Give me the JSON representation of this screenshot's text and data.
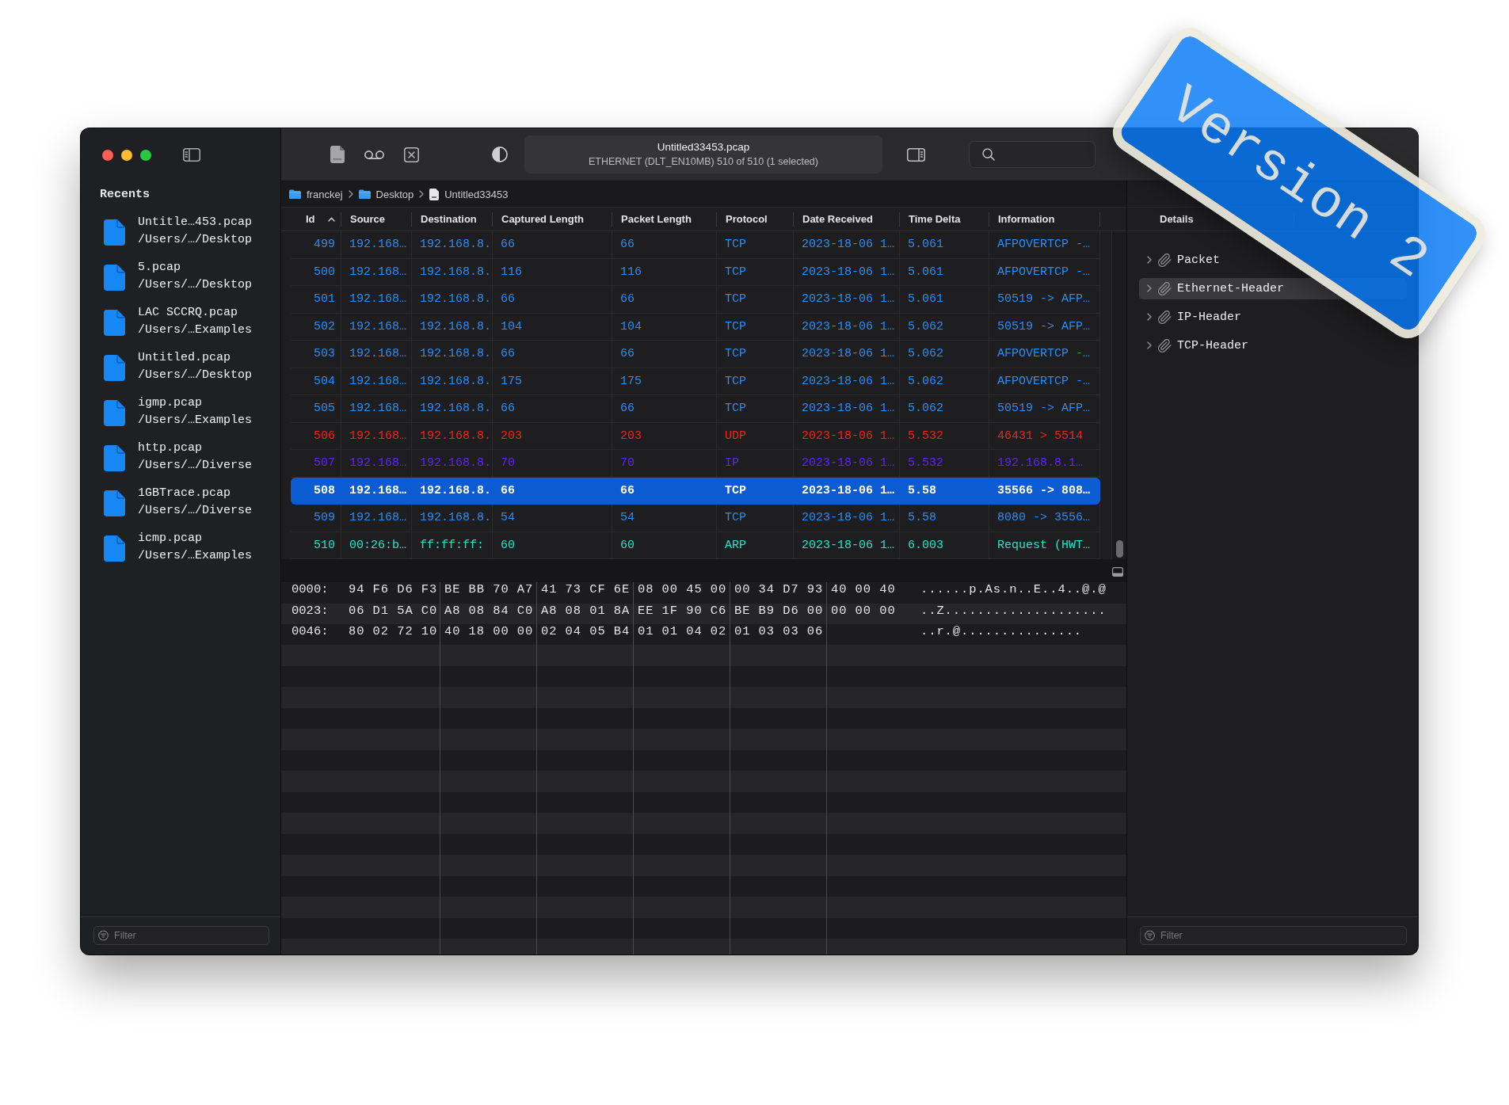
{
  "sidebar": {
    "heading": "Recents",
    "recents": [
      {
        "name": "Untitle…453.pcap",
        "path": "/Users/…/Desktop"
      },
      {
        "name": "5.pcap",
        "path": "/Users/…/Desktop"
      },
      {
        "name": "LAC SCCRQ.pcap",
        "path": "/Users/…Examples"
      },
      {
        "name": "Untitled.pcap",
        "path": "/Users/…/Desktop"
      },
      {
        "name": "igmp.pcap",
        "path": "/Users/…Examples"
      },
      {
        "name": "http.pcap",
        "path": "/Users/…/Diverse"
      },
      {
        "name": "1GBTrace.pcap",
        "path": "/Users/…/Diverse"
      },
      {
        "name": "icmp.pcap",
        "path": "/Users/…Examples"
      }
    ],
    "filter": {
      "placeholder": "Filter"
    }
  },
  "toolbar": {
    "title": "Untitled33453.pcap",
    "subtitle": "ETHERNET (DLT_EN10MB) 510 of 510 (1 selected)"
  },
  "breadcrumb": [
    {
      "kind": "folder",
      "label": "franckej"
    },
    {
      "kind": "folder",
      "label": "Desktop"
    },
    {
      "kind": "file",
      "label": "Untitled33453"
    }
  ],
  "table": {
    "columns": [
      {
        "label": "Id",
        "sorted": true
      },
      {
        "label": "Source",
        "sorted": false
      },
      {
        "label": "Destination",
        "sorted": false
      },
      {
        "label": "Captured Length",
        "sorted": false
      },
      {
        "label": "Packet Length",
        "sorted": false
      },
      {
        "label": "Protocol",
        "sorted": false
      },
      {
        "label": "Date Received",
        "sorted": false
      },
      {
        "label": "Time Delta",
        "sorted": false
      },
      {
        "label": "Information",
        "sorted": false
      }
    ],
    "rows": [
      {
        "cells": [
          "499",
          "192.168…",
          "192.168.8.",
          "66",
          "66",
          "TCP",
          "2023-18-06 1…",
          "5.061",
          "AFPOVERTCP -…"
        ],
        "color": "#2b8df2",
        "selected": false
      },
      {
        "cells": [
          "500",
          "192.168…",
          "192.168.8.",
          "116",
          "116",
          "TCP",
          "2023-18-06 1…",
          "5.061",
          "AFPOVERTCP -…"
        ],
        "color": "#2b8df2",
        "selected": false
      },
      {
        "cells": [
          "501",
          "192.168…",
          "192.168.8.",
          "66",
          "66",
          "TCP",
          "2023-18-06 1…",
          "5.061",
          "50519 -> AFP…"
        ],
        "color": "#2b8df2",
        "selected": false
      },
      {
        "cells": [
          "502",
          "192.168…",
          "192.168.8.",
          "104",
          "104",
          "TCP",
          "2023-18-06 1…",
          "5.062",
          "50519 -> AFP…"
        ],
        "color": "#2b8df2",
        "selected": false
      },
      {
        "cells": [
          "503",
          "192.168…",
          "192.168.8.",
          "66",
          "66",
          "TCP",
          "2023-18-06 1…",
          "5.062",
          "AFPOVERTCP -…"
        ],
        "color": "#2b8df2",
        "selected": false
      },
      {
        "cells": [
          "504",
          "192.168…",
          "192.168.8.",
          "175",
          "175",
          "TCP",
          "2023-18-06 1…",
          "5.062",
          "AFPOVERTCP -…"
        ],
        "color": "#2b8df2",
        "selected": false
      },
      {
        "cells": [
          "505",
          "192.168…",
          "192.168.8.",
          "66",
          "66",
          "TCP",
          "2023-18-06 1…",
          "5.062",
          "50519 -> AFP…"
        ],
        "color": "#2b8df2",
        "selected": false
      },
      {
        "cells": [
          "506",
          "192.168…",
          "192.168.8.",
          "203",
          "203",
          "UDP",
          "2023-18-06 1…",
          "5.532",
          "46431 > 5514"
        ],
        "color": "#f5221b",
        "selected": false
      },
      {
        "cells": [
          "507",
          "192.168…",
          "192.168.8.",
          "70",
          "70",
          "IP",
          "2023-18-06 1…",
          "5.532",
          "192.168.8.1…"
        ],
        "color": "#6124f2",
        "selected": false
      },
      {
        "cells": [
          "508",
          "192.168…",
          "192.168.8.",
          "66",
          "66",
          "TCP",
          "2023-18-06 1…",
          "5.58",
          "35566 -> 808…"
        ],
        "selected": true
      },
      {
        "cells": [
          "509",
          "192.168…",
          "192.168.8.",
          "54",
          "54",
          "TCP",
          "2023-18-06 1…",
          "5.58",
          "8080 -> 3556…"
        ],
        "color": "#2b8df2",
        "selected": false
      },
      {
        "cells": [
          "510",
          "00:26:b…",
          "ff:ff:ff:",
          "60",
          "60",
          "ARP",
          "2023-18-06 1…",
          "6.003",
          "Request (HWT…"
        ],
        "color": "#26e3cb",
        "selected": false
      }
    ]
  },
  "hex": {
    "rows": [
      {
        "offset": "0000:",
        "groups": [
          "94 F6 D6 F3",
          "BE BB 70 A7",
          "41 73 CF 6E",
          "08 00 45 00",
          "00 34 D7 93",
          "40 00 40"
        ],
        "ascii": "......p.As.n..E..4..@.@"
      },
      {
        "offset": "0023:",
        "groups": [
          "06 D1 5A C0",
          "A8 08 84 C0",
          "A8 08 01 8A",
          "EE 1F 90 C6",
          "BE B9 D6 00",
          "00 00 00"
        ],
        "ascii": "..Z...................."
      },
      {
        "offset": "0046:",
        "groups": [
          "80 02 72 10",
          "40 18 00 00",
          "02 04 05 B4",
          "01 01 04 02",
          "01 03 03 06"
        ],
        "ascii": "..r.@..............."
      }
    ]
  },
  "details": {
    "heading": "Details",
    "items": [
      {
        "label": "Packet",
        "selected": false,
        "expanded": false
      },
      {
        "label": "Ethernet-Header",
        "selected": true,
        "expanded": false
      },
      {
        "label": "IP-Header",
        "selected": false,
        "expanded": false
      },
      {
        "label": "TCP-Header",
        "selected": false,
        "expanded": false
      }
    ],
    "filter": {
      "placeholder": "Filter"
    }
  },
  "badge": {
    "text": "Version 2"
  }
}
